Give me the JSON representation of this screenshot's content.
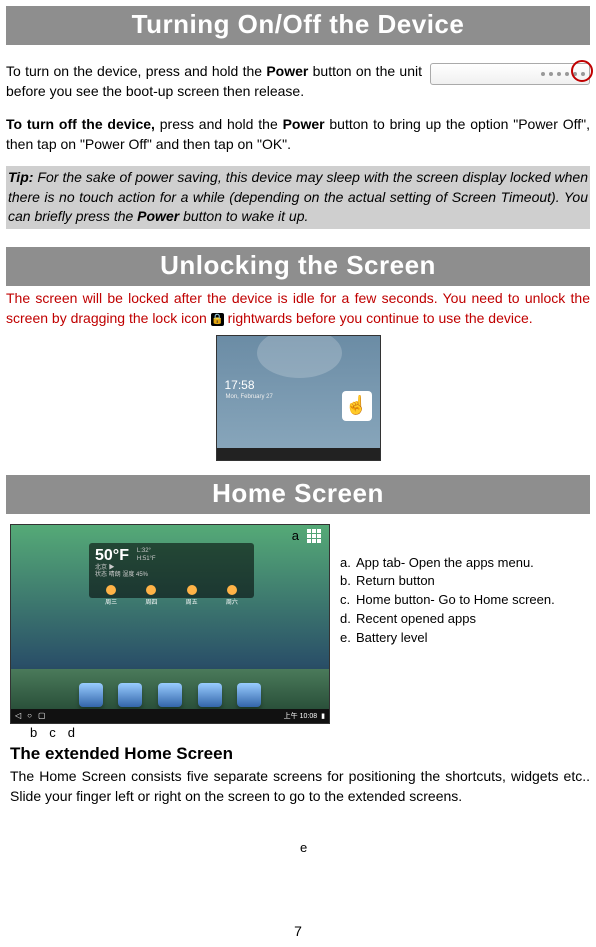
{
  "sections": {
    "turningOnOff": {
      "title": "Turning On/Off the Device",
      "p1_a": "To turn on the device, press and hold the ",
      "p1_b": "Power",
      "p1_c": " button on the unit before you see the boot-up screen then release.",
      "p2_a": "To turn off the device,",
      "p2_b": " press and hold the ",
      "p2_c": "Power",
      "p2_d": " button to bring up the option \"Power Off\", then tap on \"Power Off\" and then tap on \"OK\".",
      "tip_a": "Tip:",
      "tip_b": " For the sake of power saving, this device may sleep with the screen display locked when there is no touch action for a while (depending on the actual setting of Screen Timeout). You can briefly press the ",
      "tip_c": "Power",
      "tip_d": " button to wake it up."
    },
    "unlocking": {
      "title": "Unlocking the Screen",
      "text_a": "The screen will be locked after the device is idle for a few seconds. You need to unlock the screen by dragging the lock icon ",
      "text_b": " rightwards before you continue to use the device.",
      "time": "17:58",
      "date": "Mon, February 27"
    },
    "home": {
      "title": "Home Screen",
      "weatherTemp": "50°F",
      "weatherLoc": "北京",
      "weatherInfo": "状态 晴朗 湿度 45%",
      "labels": {
        "a": "a",
        "b": "b",
        "c": "c",
        "d": "d",
        "e": "e"
      },
      "legend": {
        "a": {
          "k": "a.",
          "v": "App tab- Open the apps menu."
        },
        "b": {
          "k": "b.",
          "v": "Return button"
        },
        "c": {
          "k": "c.",
          "v": "Home button- Go to Home screen."
        },
        "d": {
          "k": "d.",
          "v": "Recent opened apps"
        },
        "e": {
          "k": "e.",
          "v": "Battery level"
        }
      },
      "subheading": "The extended Home Screen",
      "p1": "The Home Screen consists five separate screens for positioning the shortcuts, widgets etc.. Slide your finger left or right on the screen to go to the extended screens.",
      "statusTime": "上午 10:08"
    }
  },
  "pageNumber": "7"
}
